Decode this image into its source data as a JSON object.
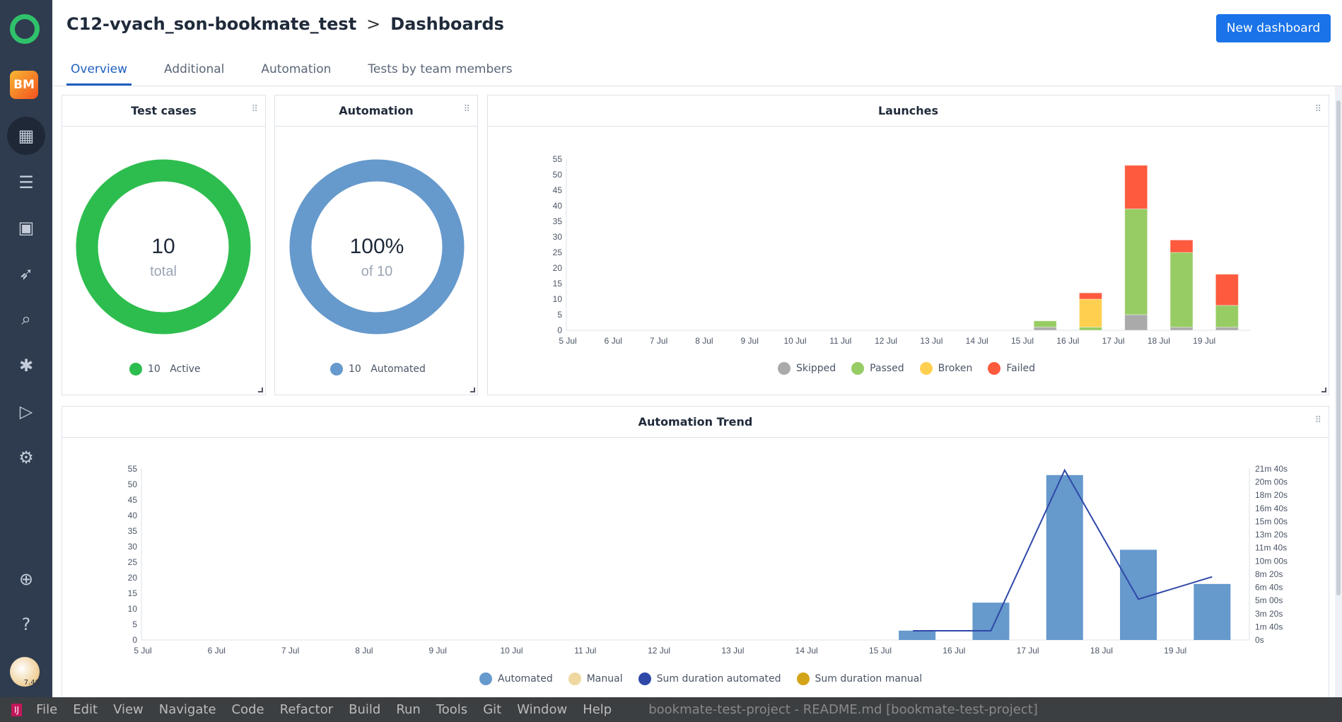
{
  "header": {
    "project": "C12-vyach_son-bookmate_test",
    "separator": ">",
    "page": "Dashboards",
    "new_button": "New dashboard"
  },
  "tabs": [
    {
      "label": "Overview",
      "active": true
    },
    {
      "label": "Additional"
    },
    {
      "label": "Automation"
    },
    {
      "label": "Tests by team members"
    }
  ],
  "sidebar": {
    "project_badge": "BM",
    "avatar_text": "7.40",
    "items": [
      "dashboards-icon",
      "test-cases-icon",
      "test-plans-icon",
      "launches-icon",
      "analytics-icon",
      "defects-icon",
      "jobs-icon",
      "settings-icon"
    ],
    "bottom": [
      "add-icon",
      "help-icon"
    ]
  },
  "test_cases": {
    "title": "Test cases",
    "value": "10",
    "sub": "total",
    "legend_count": "10",
    "legend_label": "Active",
    "color": "#2dbd4e"
  },
  "automation": {
    "title": "Automation",
    "value": "100%",
    "sub": "of 10",
    "legend_count": "10",
    "legend_label": "Automated",
    "color": "#6699cc"
  },
  "chart_data": [
    {
      "type": "bar",
      "stacked": true,
      "title": "Launches",
      "categories": [
        "5 Jul",
        "6 Jul",
        "7 Jul",
        "8 Jul",
        "9 Jul",
        "10 Jul",
        "11 Jul",
        "12 Jul",
        "13 Jul",
        "14 Jul",
        "15 Jul",
        "16 Jul",
        "17 Jul",
        "18 Jul",
        "19 Jul"
      ],
      "ylim": [
        0,
        55
      ],
      "yticks": [
        0,
        5,
        10,
        15,
        20,
        25,
        30,
        35,
        40,
        45,
        50,
        55
      ],
      "legend": "bottom",
      "series": [
        {
          "name": "Skipped",
          "color": "#aaaaaa",
          "values": [
            0,
            0,
            0,
            0,
            0,
            0,
            0,
            0,
            0,
            0,
            1,
            0,
            5,
            1,
            1
          ]
        },
        {
          "name": "Passed",
          "color": "#97cc64",
          "values": [
            0,
            0,
            0,
            0,
            0,
            0,
            0,
            0,
            0,
            0,
            2,
            1,
            34,
            24,
            7
          ]
        },
        {
          "name": "Broken",
          "color": "#ffd050",
          "values": [
            0,
            0,
            0,
            0,
            0,
            0,
            0,
            0,
            0,
            0,
            0,
            9,
            0,
            0,
            0
          ]
        },
        {
          "name": "Failed",
          "color": "#fd5a3e",
          "values": [
            0,
            0,
            0,
            0,
            0,
            0,
            0,
            0,
            0,
            0,
            0,
            2,
            14,
            4,
            10
          ]
        }
      ]
    },
    {
      "type": "bar+line",
      "title": "Automation Trend",
      "categories": [
        "5 Jul",
        "6 Jul",
        "7 Jul",
        "8 Jul",
        "9 Jul",
        "10 Jul",
        "11 Jul",
        "12 Jul",
        "13 Jul",
        "14 Jul",
        "15 Jul",
        "16 Jul",
        "17 Jul",
        "18 Jul",
        "19 Jul"
      ],
      "ylim": [
        0,
        55
      ],
      "yticks": [
        0,
        5,
        10,
        15,
        20,
        25,
        30,
        35,
        40,
        45,
        50,
        55
      ],
      "y2ticks": [
        "0s",
        "1m 40s",
        "3m 20s",
        "5m 00s",
        "6m 40s",
        "8m 20s",
        "10m 00s",
        "11m 40s",
        "13m 20s",
        "15m 00s",
        "16m 40s",
        "18m 20s",
        "20m 00s",
        "21m 40s"
      ],
      "y2lim_seconds": [
        0,
        1300
      ],
      "legend": "bottom",
      "series": [
        {
          "name": "Automated",
          "type": "bar",
          "color": "#6699cc",
          "values": [
            0,
            0,
            0,
            0,
            0,
            0,
            0,
            0,
            0,
            0,
            3,
            12,
            53,
            29,
            18
          ]
        },
        {
          "name": "Manual",
          "type": "bar",
          "color": "#eed8a0",
          "values": [
            0,
            0,
            0,
            0,
            0,
            0,
            0,
            0,
            0,
            0,
            0,
            0,
            0,
            0,
            0
          ]
        },
        {
          "name": "Sum duration automated",
          "type": "line",
          "axis": "right",
          "color": "#2f48a8",
          "values_seconds": [
            null,
            null,
            null,
            null,
            null,
            null,
            null,
            null,
            null,
            null,
            70,
            70,
            1290,
            310,
            480
          ]
        },
        {
          "name": "Sum duration manual",
          "type": "line",
          "axis": "right",
          "color": "#d4a418",
          "values_seconds": []
        }
      ]
    }
  ],
  "ide": {
    "menu": [
      "File",
      "Edit",
      "View",
      "Navigate",
      "Code",
      "Refactor",
      "Build",
      "Run",
      "Tools",
      "Git",
      "Window",
      "Help"
    ],
    "title": "bookmate-test-project - README.md [bookmate-test-project]"
  }
}
